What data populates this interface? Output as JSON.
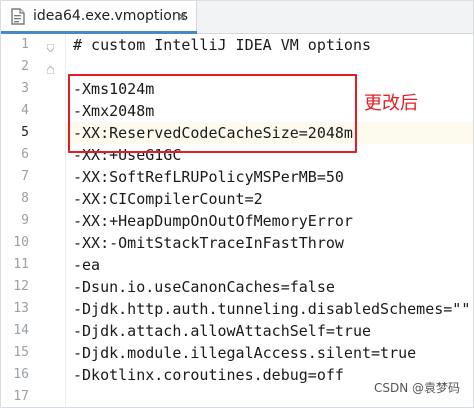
{
  "tab": {
    "file_name": "idea64.exe.vmoptions",
    "close_icon": "close-icon",
    "file_icon": "file-icon"
  },
  "editor": {
    "line_numbers": [
      "1",
      "2",
      "3",
      "4",
      "5",
      "6",
      "7",
      "8",
      "9",
      "10",
      "11",
      "12",
      "13",
      "14",
      "15",
      "16",
      "17"
    ],
    "current_line": "5",
    "lines": [
      "# custom IntelliJ IDEA VM options",
      "",
      "-Xms1024m",
      "-Xmx2048m",
      "-XX:ReservedCodeCacheSize=2048m",
      "-XX:+UseG1GC",
      "-XX:SoftRefLRUPolicyMSPerMB=50",
      "-XX:CICompilerCount=2",
      "-XX:+HeapDumpOnOutOfMemoryError",
      "-XX:-OmitStackTraceInFastThrow",
      "-ea",
      "-Dsun.io.useCanonCaches=false",
      "-Djdk.http.auth.tunneling.disabledSchemes=\"\"",
      "-Djdk.attach.allowAttachSelf=true",
      "-Djdk.module.illegalAccess.silent=true",
      "-Dkotlinx.coroutines.debug=off",
      ""
    ]
  },
  "annotation": {
    "text": "更改后",
    "color": "#e51c24"
  },
  "watermark": {
    "text": "CSDN @袁梦码"
  },
  "colors": {
    "accent": "#4a86c8",
    "current_line": "#fcfaed",
    "highlight": "#e51c24"
  }
}
